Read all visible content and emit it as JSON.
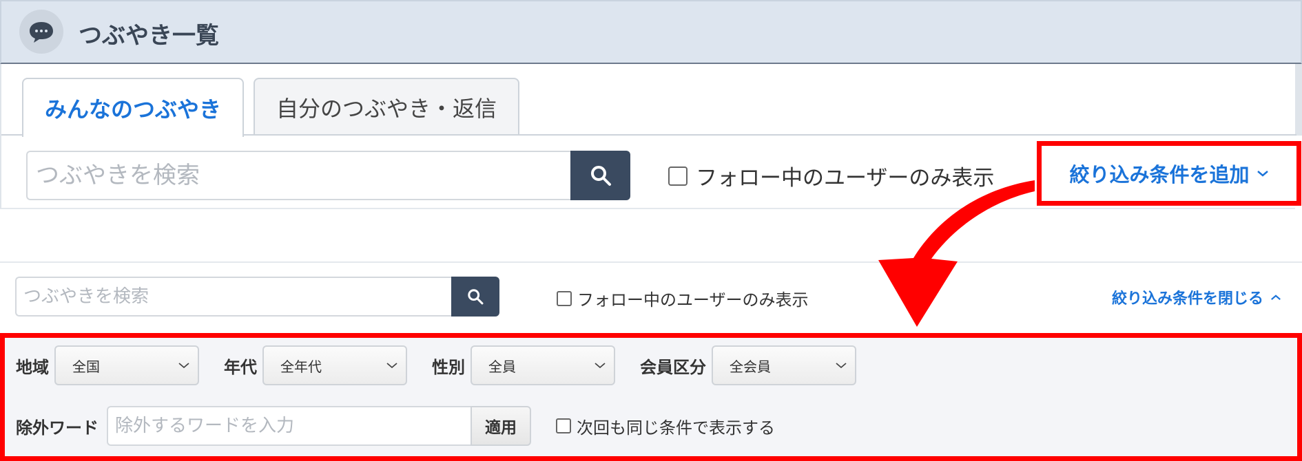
{
  "header": {
    "title": "つぶやき一覧",
    "icon": "chat-bubble-icon"
  },
  "tabs": [
    {
      "label": "みんなのつぶやき",
      "active": true
    },
    {
      "label": "自分のつぶやき・返信",
      "active": false
    }
  ],
  "search_collapsed": {
    "placeholder": "つぶやきを検索",
    "follow_only_label": "フォロー中のユーザーのみ表示",
    "add_filter_label": "絞り込み条件を追加"
  },
  "search_expanded": {
    "placeholder": "つぶやきを検索",
    "follow_only_label": "フォロー中のユーザーのみ表示",
    "close_filter_label": "絞り込み条件を閉じる"
  },
  "filters": {
    "region": {
      "label": "地域",
      "value": "全国"
    },
    "age": {
      "label": "年代",
      "value": "全年代"
    },
    "gender": {
      "label": "性別",
      "value": "全員"
    },
    "membership": {
      "label": "会員区分",
      "value": "全会員"
    },
    "exclude_words": {
      "label": "除外ワード",
      "placeholder": "除外するワードを入力",
      "apply_label": "適用"
    },
    "remember_label": "次回も同じ条件で表示する"
  },
  "colors": {
    "accent": "#1a73d9",
    "highlight": "#ff0000",
    "search_button": "#3a4a60",
    "header_bg": "#dde5ef"
  }
}
